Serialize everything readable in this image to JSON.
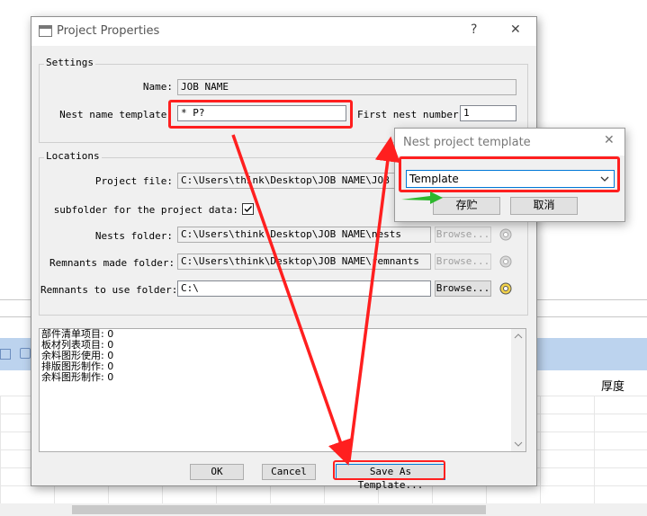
{
  "background": {
    "column_header": "厚度"
  },
  "dialog": {
    "title": "Project Properties",
    "help_glyph": "?",
    "close_glyph": "✕",
    "settings": {
      "legend": "Settings",
      "name_label": "Name:",
      "name_value": "JOB NAME",
      "nest_template_label": "Nest name template:",
      "nest_template_value": "* P?",
      "first_nest_label": "First nest number:",
      "first_nest_value": "1"
    },
    "locations": {
      "legend": "Locations",
      "project_file_label": "Project file:",
      "project_file_value": "C:\\Users\\think\\Desktop\\JOB NAME\\JOB NAME",
      "subfolder_label": "subfolder for the project data:",
      "subfolder_checked": true,
      "nests_folder_label": "Nests folder:",
      "nests_folder_value": "C:\\Users\\think\\Desktop\\JOB NAME\\nests",
      "remnants_made_label": "Remnants made folder:",
      "remnants_made_value": "C:\\Users\\think\\Desktop\\JOB NAME\\remnants",
      "remnants_use_label": "Remnants to use folder:",
      "remnants_use_value": "C:\\",
      "browse_label": "Browse..."
    },
    "log_lines": [
      "部件清单项目: 0",
      "板材列表项目: 0",
      "余料图形使用: 0",
      "排版图形制作: 0",
      "余料图形制作: 0"
    ],
    "buttons": {
      "ok": "OK",
      "cancel": "Cancel",
      "save_template": "Save As Template..."
    }
  },
  "sub_dialog": {
    "title": "Nest project template",
    "close_glyph": "✕",
    "template_value": "Template",
    "save_button": "存贮",
    "cancel_button": "取消"
  },
  "colors": {
    "annotation_red": "#ff1f1f",
    "annotation_green": "#2db82d",
    "focus_blue": "#0078d7"
  }
}
